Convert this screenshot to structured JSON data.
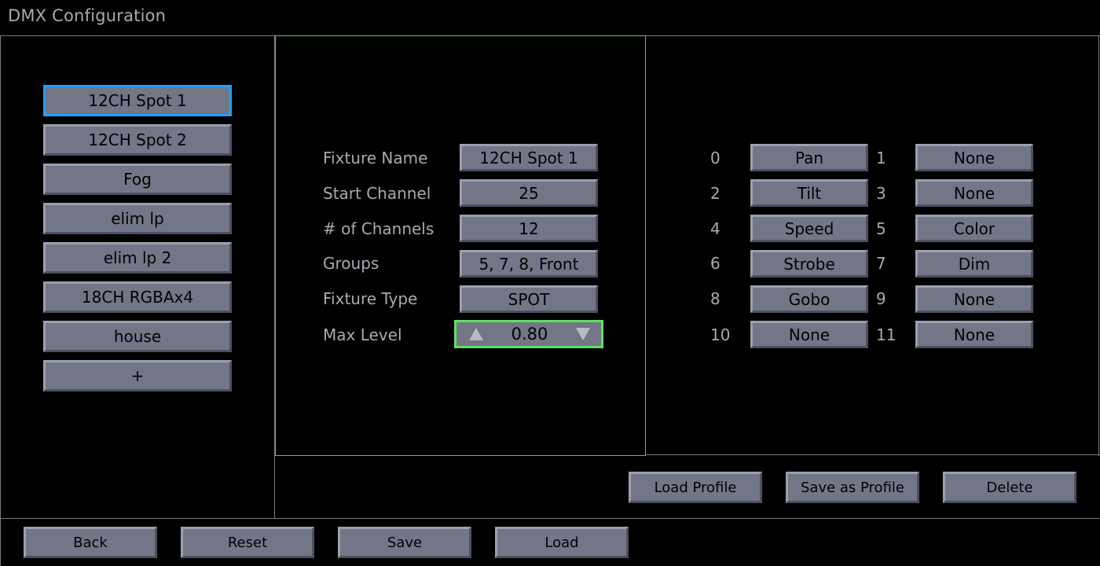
{
  "window": {
    "title": "DMX Configuration"
  },
  "fixtures": [
    {
      "label": "12CH Spot 1",
      "selected": true
    },
    {
      "label": "12CH Spot 2",
      "selected": false
    },
    {
      "label": "Fog",
      "selected": false
    },
    {
      "label": "elim lp",
      "selected": false
    },
    {
      "label": "elim lp 2",
      "selected": false
    },
    {
      "label": "18CH RGBAx4",
      "selected": false
    },
    {
      "label": "house",
      "selected": false
    },
    {
      "label": "+",
      "selected": false
    }
  ],
  "details": {
    "fixture_name": {
      "label": "Fixture Name",
      "value": "12CH Spot 1"
    },
    "start_channel": {
      "label": "Start Channel",
      "value": "25"
    },
    "num_channels": {
      "label": "# of Channels",
      "value": "12"
    },
    "groups": {
      "label": "Groups",
      "value": "5, 7, 8, Front"
    },
    "fixture_type": {
      "label": "Fixture Type",
      "value": "SPOT"
    },
    "max_level": {
      "label": "Max Level",
      "value": "0.80"
    }
  },
  "channels": [
    {
      "num": "0",
      "value": "Pan"
    },
    {
      "num": "1",
      "value": "None"
    },
    {
      "num": "2",
      "value": "Tilt"
    },
    {
      "num": "3",
      "value": "None"
    },
    {
      "num": "4",
      "value": "Speed"
    },
    {
      "num": "5",
      "value": "Color"
    },
    {
      "num": "6",
      "value": "Strobe"
    },
    {
      "num": "7",
      "value": "Dim"
    },
    {
      "num": "8",
      "value": "Gobo"
    },
    {
      "num": "9",
      "value": "None"
    },
    {
      "num": "10",
      "value": "None"
    },
    {
      "num": "11",
      "value": "None"
    }
  ],
  "profile_actions": {
    "load_profile": "Load Profile",
    "save_as_profile": "Save as Profile",
    "delete": "Delete"
  },
  "footer": {
    "back": "Back",
    "reset": "Reset",
    "save": "Save",
    "load": "Load"
  },
  "colors": {
    "background": "#000000",
    "button_face": "#737687",
    "selected_border": "#1ea0ff",
    "focus_border": "#5fe05f",
    "label_text": "#a9a9b4"
  }
}
